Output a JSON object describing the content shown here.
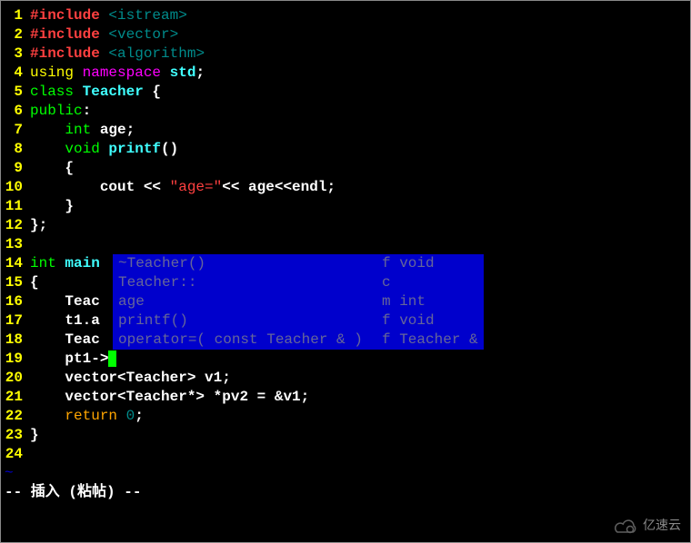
{
  "code_lines": [
    {
      "num": "1",
      "segments": [
        {
          "t": "#include ",
          "c": "c-red"
        },
        {
          "t": "<istream>",
          "c": "c-darkcyan"
        }
      ]
    },
    {
      "num": "2",
      "segments": [
        {
          "t": "#include ",
          "c": "c-red"
        },
        {
          "t": "<vector>",
          "c": "c-darkcyan"
        }
      ]
    },
    {
      "num": "3",
      "segments": [
        {
          "t": "#include ",
          "c": "c-red"
        },
        {
          "t": "<algorithm>",
          "c": "c-darkcyan"
        }
      ]
    },
    {
      "num": "4",
      "segments": [
        {
          "t": "using ",
          "c": "c-yellow"
        },
        {
          "t": "namespace ",
          "c": "c-magenta"
        },
        {
          "t": "std",
          "c": "c-cyan"
        },
        {
          "t": ";",
          "c": "c-white"
        }
      ]
    },
    {
      "num": "5",
      "segments": [
        {
          "t": "class ",
          "c": "c-green"
        },
        {
          "t": "Teacher ",
          "c": "c-cyan"
        },
        {
          "t": "{",
          "c": "c-white"
        }
      ]
    },
    {
      "num": "6",
      "segments": [
        {
          "t": "public",
          "c": "c-green"
        },
        {
          "t": ":",
          "c": "c-white"
        }
      ]
    },
    {
      "num": "7",
      "segments": [
        {
          "t": "    int ",
          "c": "c-green"
        },
        {
          "t": "age;",
          "c": "c-white"
        }
      ]
    },
    {
      "num": "8",
      "segments": [
        {
          "t": "    void ",
          "c": "c-green"
        },
        {
          "t": "printf",
          "c": "c-cyan"
        },
        {
          "t": "()",
          "c": "c-white"
        }
      ]
    },
    {
      "num": "9",
      "segments": [
        {
          "t": "    {",
          "c": "c-white"
        }
      ]
    },
    {
      "num": "10",
      "segments": [
        {
          "t": "        cout << ",
          "c": "c-white"
        },
        {
          "t": "\"age=\"",
          "c": "c-str"
        },
        {
          "t": "<< age<<endl;",
          "c": "c-white"
        }
      ]
    },
    {
      "num": "11",
      "segments": [
        {
          "t": "    }",
          "c": "c-white"
        }
      ]
    },
    {
      "num": "12",
      "segments": [
        {
          "t": "};",
          "c": "c-white"
        }
      ]
    },
    {
      "num": "13",
      "segments": []
    },
    {
      "num": "14",
      "segments": [
        {
          "t": "int ",
          "c": "c-green"
        },
        {
          "t": "main",
          "c": "c-cyan"
        }
      ]
    },
    {
      "num": "15",
      "segments": [
        {
          "t": "{",
          "c": "c-white"
        }
      ]
    },
    {
      "num": "16",
      "segments": [
        {
          "t": "    Teac",
          "c": "c-white"
        }
      ]
    },
    {
      "num": "17",
      "segments": [
        {
          "t": "    t1.a",
          "c": "c-white"
        }
      ]
    },
    {
      "num": "18",
      "segments": [
        {
          "t": "    Teac",
          "c": "c-white"
        }
      ]
    },
    {
      "num": "19",
      "segments": [
        {
          "t": "    pt1->",
          "c": "c-white"
        },
        {
          "t": "",
          "c": "cursor-here"
        }
      ]
    },
    {
      "num": "20",
      "segments": [
        {
          "t": "    vector<Teacher> v1;",
          "c": "c-white"
        }
      ]
    },
    {
      "num": "21",
      "segments": [
        {
          "t": "    vector<Teacher*> *pv2 = &v1;",
          "c": "c-white"
        }
      ]
    },
    {
      "num": "22",
      "segments": [
        {
          "t": "    ",
          "c": "c-white"
        },
        {
          "t": "return ",
          "c": "c-orange"
        },
        {
          "t": "0",
          "c": "c-darkcyan"
        },
        {
          "t": ";",
          "c": "c-white"
        }
      ]
    },
    {
      "num": "23",
      "segments": [
        {
          "t": "}",
          "c": "c-white"
        }
      ]
    },
    {
      "num": "24",
      "segments": []
    }
  ],
  "popup_items": [
    {
      "left": "~Teacher()",
      "right": "f void"
    },
    {
      "left": "Teacher::",
      "right": "c"
    },
    {
      "left": "age",
      "right": "m int"
    },
    {
      "left": "printf()",
      "right": "f void"
    },
    {
      "left": "operator=( const Teacher & )",
      "right": "f Teacher &"
    }
  ],
  "tilde": "~",
  "status_text": "-- 插入 (粘帖) --",
  "watermark_text": "亿速云"
}
